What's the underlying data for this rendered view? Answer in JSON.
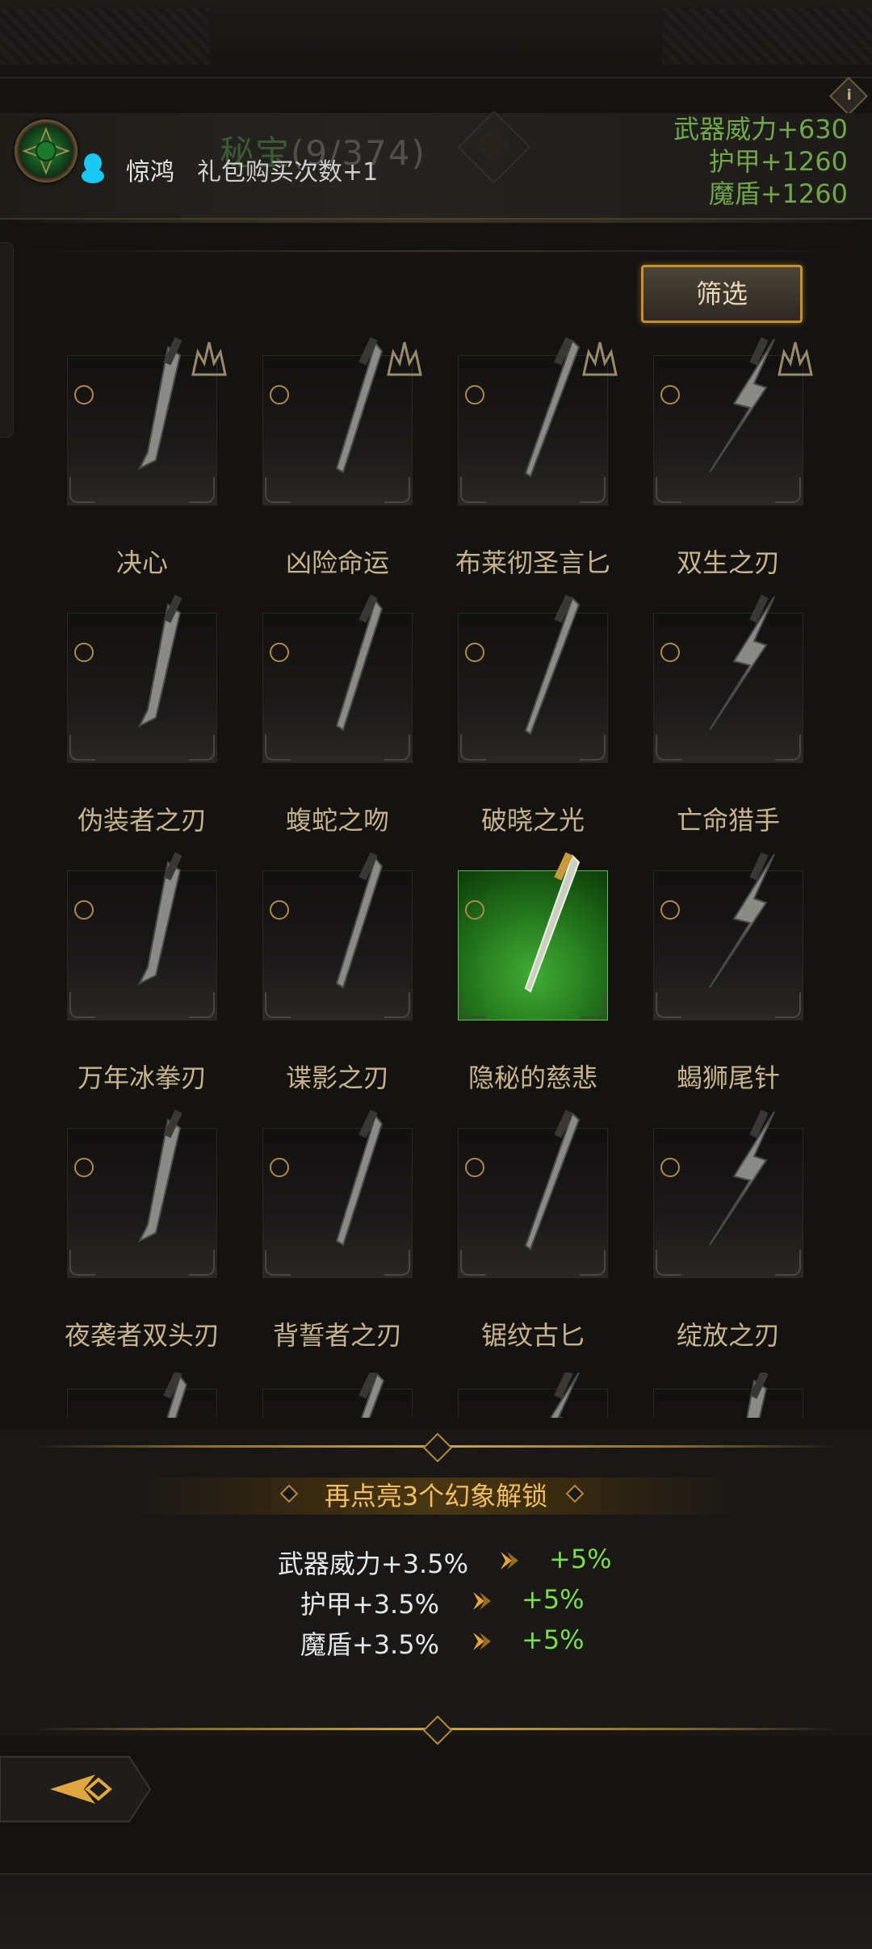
{
  "header": {
    "title": "秘宝",
    "count": "(9/374)",
    "chat_user": "惊鸿",
    "chat_message": "礼包购买次数+1"
  },
  "stats": [
    {
      "label": "武器威力+630"
    },
    {
      "label": "护甲+1260"
    },
    {
      "label": "魔盾+1260"
    }
  ],
  "info_icon": "i",
  "filter_label": "筛选",
  "items": [
    {
      "name": "决心",
      "badge": true,
      "selected": false
    },
    {
      "name": "凶险命运",
      "badge": true,
      "selected": false
    },
    {
      "name": "布莱彻圣言匕",
      "badge": true,
      "selected": false
    },
    {
      "name": "双生之刃",
      "badge": true,
      "selected": false
    },
    {
      "name": "伪装者之刃",
      "badge": false,
      "selected": false
    },
    {
      "name": "蝮蛇之吻",
      "badge": false,
      "selected": false
    },
    {
      "name": "破晓之光",
      "badge": false,
      "selected": false
    },
    {
      "name": "亡命猎手",
      "badge": false,
      "selected": false
    },
    {
      "name": "万年冰拳刃",
      "badge": false,
      "selected": false
    },
    {
      "name": "谍影之刃",
      "badge": false,
      "selected": false
    },
    {
      "name": "隐秘的慈悲",
      "badge": false,
      "selected": true
    },
    {
      "name": "蝎狮尾针",
      "badge": false,
      "selected": false
    },
    {
      "name": "夜袭者双头刃",
      "badge": false,
      "selected": false
    },
    {
      "name": "背誓者之刃",
      "badge": false,
      "selected": false
    },
    {
      "name": "锯纹古匕",
      "badge": false,
      "selected": false
    },
    {
      "name": "绽放之刃",
      "badge": false,
      "selected": false
    }
  ],
  "unlock": {
    "text": "再点亮3个幻象解锁",
    "bonuses": [
      {
        "current": "武器威力+3.5%",
        "next": "+5%"
      },
      {
        "current": "护甲+3.5%",
        "next": "+5%"
      },
      {
        "current": "魔盾+3.5%",
        "next": "+5%"
      }
    ]
  },
  "colors": {
    "accent_gold": "#d4a54a",
    "stat_green": "#6fa84a",
    "bonus_green": "#77e04a",
    "selected_tile": "#3fae32"
  },
  "icons": [
    "info-icon",
    "qq-avatar-icon",
    "crest-emblem-icon",
    "back-arrow-icon",
    "dagger-icon",
    "rank-badge-icon",
    "upgrade-arrow-icon"
  ]
}
